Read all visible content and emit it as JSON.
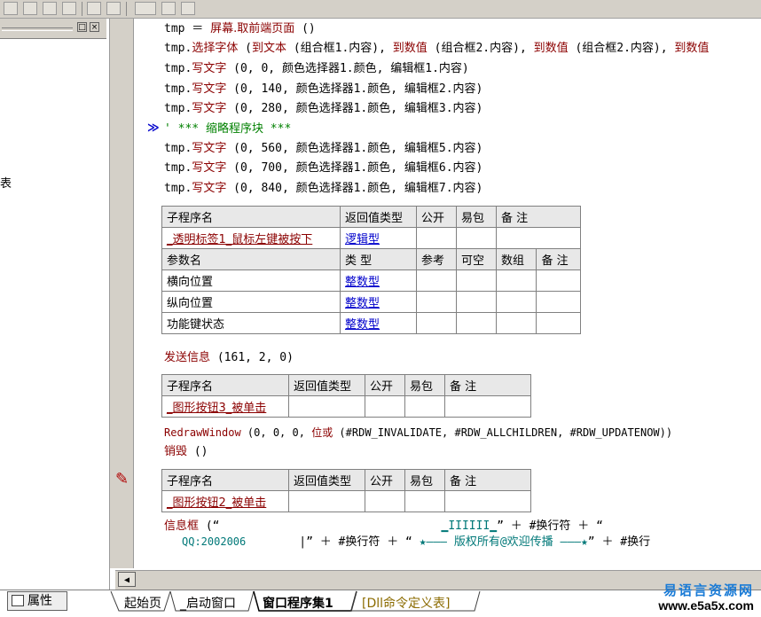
{
  "code": {
    "l1": {
      "obj": "tmp",
      "eq": " ＝ ",
      "fn": "屏幕.取前端页面",
      "args": " ()"
    },
    "l2": {
      "obj": "tmp.",
      "fn": "选择字体",
      "rest1": " (",
      "a1": "到文本",
      "r1": " (组合框1.内容), ",
      "a2": "到数值",
      "r2": " (组合框2.内容), ",
      "a3": "到数值",
      "r3": " (组合框2.内容), ",
      "a4": "到数值"
    },
    "write_lines": [
      {
        "obj": "tmp.",
        "fn": "写文字",
        "args": " (0, 0, 颜色选择器1.颜色, 编辑框1.内容)"
      },
      {
        "obj": "tmp.",
        "fn": "写文字",
        "args": " (0, 140, 颜色选择器1.颜色, 编辑框2.内容)"
      },
      {
        "obj": "tmp.",
        "fn": "写文字",
        "args": " (0, 280, 颜色选择器1.颜色, 编辑框3.内容)"
      }
    ],
    "collapsed": {
      "marker": "≫",
      "text": "' *** 缩略程序块 ***"
    },
    "write_lines2": [
      {
        "obj": "tmp.",
        "fn": "写文字",
        "args": " (0, 560, 颜色选择器1.颜色, 编辑框5.内容)"
      },
      {
        "obj": "tmp.",
        "fn": "写文字",
        "args": " (0, 700, 颜色选择器1.颜色, 编辑框6.内容)"
      },
      {
        "obj": "tmp.",
        "fn": "写文字",
        "args": " (0, 840, 颜色选择器1.颜色, 编辑框7.内容)"
      }
    ],
    "send": {
      "fn": "发送信息",
      "args": " (161, 2, 0)"
    },
    "redraw": {
      "fn": "RedrawWindow",
      "args1": " (0, 0, 0, ",
      "op": "位或",
      "args2": " (#RDW_INVALIDATE, #RDW_ALLCHILDREN, #RDW_UPDATENOW))"
    },
    "destroy": {
      "fn": "销毁",
      "args": " ()"
    },
    "msgbox": {
      "fn": "信息框",
      "a": " (“",
      "b": "▁IIIIII▁",
      "c": "” ＋ #换行符 ＋ “"
    },
    "msgbox2": {
      "qq": "QQ:2002006",
      "a": "|” ＋ #换行符 ＋ “ ",
      "b": "★——— 版权所有@欢迎传播 ———★",
      "c": "” ＋ #换行"
    }
  },
  "table1": {
    "headers": [
      "子程序名",
      "返回值类型",
      "公开",
      "易包",
      "备 注"
    ],
    "row": [
      "_透明标签1_鼠标左键被按下",
      "逻辑型",
      "",
      "",
      ""
    ],
    "param_headers": [
      "参数名",
      "类 型",
      "参考",
      "可空",
      "数组",
      "备 注"
    ],
    "params": [
      [
        "横向位置",
        "整数型"
      ],
      [
        "纵向位置",
        "整数型"
      ],
      [
        "功能键状态",
        "整数型"
      ]
    ]
  },
  "table2": {
    "headers": [
      "子程序名",
      "返回值类型",
      "公开",
      "易包",
      "备 注"
    ],
    "row": [
      "_图形按钮3_被单击",
      "",
      "",
      "",
      ""
    ]
  },
  "table3": {
    "headers": [
      "子程序名",
      "返回值类型",
      "公开",
      "易包",
      "备 注"
    ],
    "row": [
      "_图形按钮2_被单击",
      "",
      "",
      "",
      ""
    ]
  },
  "left": {
    "side_char": "表"
  },
  "bottom": {
    "prop_label": "属性",
    "tabs": [
      "起始页",
      "_启动窗口",
      "窗口程序集1",
      "[Dll命令定义表]"
    ],
    "watermark_cn": "易语言资源网",
    "watermark_url": "www.e5a5x.com"
  },
  "colors": {
    "keyword": "#8b0000",
    "link": "#0000cc",
    "comment": "#008000"
  }
}
